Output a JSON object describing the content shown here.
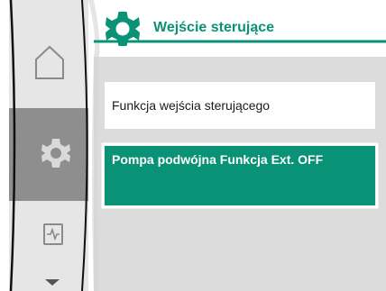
{
  "header": {
    "title": "Wejście sterujące",
    "icon": "gear-icon"
  },
  "menu": {
    "items": [
      {
        "label": "Funkcja wejścia sterującego",
        "selected": false
      },
      {
        "label": "Pompa podwójna Funkcja Ext. OFF",
        "selected": true
      }
    ]
  },
  "sidebar": {
    "items": [
      {
        "name": "home",
        "icon": "home-icon",
        "active": false
      },
      {
        "name": "settings",
        "icon": "gear-icon",
        "active": true
      },
      {
        "name": "diagnostics",
        "icon": "pulse-icon",
        "active": false
      }
    ],
    "scroll_indicator": "chevron-down-icon"
  },
  "colors": {
    "accent": "#0a9276",
    "sidebar_active": "#8e8e8e",
    "panel_bg": "#dcdcdc",
    "sidebar_bg": "#e6e6e6"
  }
}
